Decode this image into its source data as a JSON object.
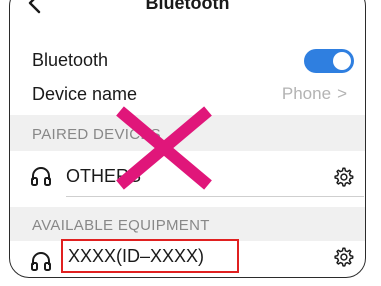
{
  "header": {
    "title": "Bluetooth"
  },
  "settings": {
    "bluetooth_label": "Bluetooth",
    "bluetooth_on": true,
    "device_name_label": "Device name",
    "device_name_value": "Phone",
    "device_name_chevron": ">"
  },
  "paired": {
    "section_title": "PAIRED DEVICES",
    "items": [
      {
        "label": "OTHERS",
        "icon": "headphones-icon"
      }
    ]
  },
  "available": {
    "section_title": "AVAILABLE EQUIPMENT",
    "items": [
      {
        "label": "XXXX(ID–XXXX)",
        "icon": "headphones-icon"
      }
    ]
  },
  "colors": {
    "toggle_on": "#2f7fe0",
    "cross_mark": "#e0167a",
    "highlight_box": "#e02020"
  }
}
